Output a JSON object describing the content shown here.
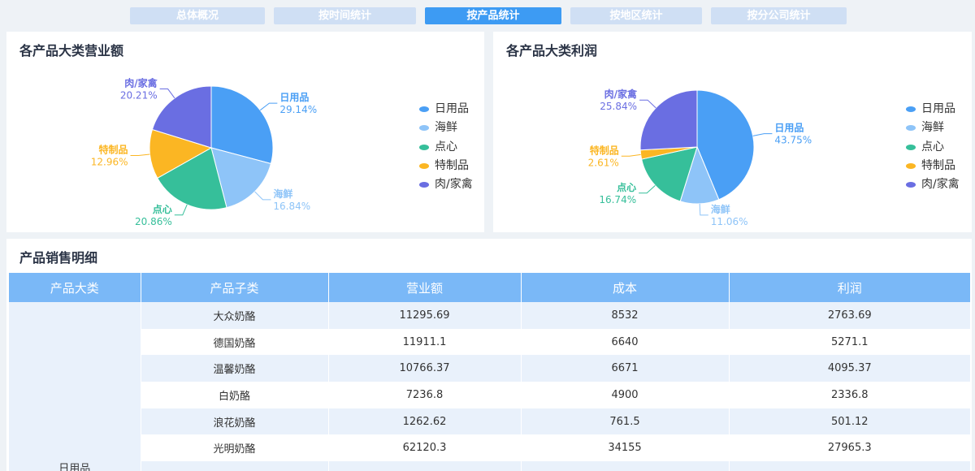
{
  "tabs": [
    "总体概况",
    "按时间统计",
    "按产品统计",
    "按地区统计",
    "按分公司统计"
  ],
  "active_tab": 2,
  "revenue_panel": {
    "title": "各产品大类营业额"
  },
  "profit_panel": {
    "title": "各产品大类利润"
  },
  "legend": [
    {
      "label": "日用品",
      "color": "#4a9ff5"
    },
    {
      "label": "海鲜",
      "color": "#8ec4f8"
    },
    {
      "label": "点心",
      "color": "#36bf9a"
    },
    {
      "label": "特制品",
      "color": "#fbb623"
    },
    {
      "label": "肉/家禽",
      "color": "#6a6ee2"
    }
  ],
  "chart_data": [
    {
      "type": "pie",
      "title": "各产品大类营业额",
      "categories": [
        "日用品",
        "海鲜",
        "点心",
        "特制品",
        "肉/家禽"
      ],
      "values": [
        29.14,
        16.84,
        20.86,
        12.96,
        20.21
      ],
      "labels": [
        "29.14%",
        "16.84%",
        "20.86%",
        "12.96%",
        "20.21%"
      ],
      "legend_position": "right"
    },
    {
      "type": "pie",
      "title": "各产品大类利润",
      "categories": [
        "日用品",
        "海鲜",
        "点心",
        "特制品",
        "肉/家禽"
      ],
      "values": [
        43.75,
        11.06,
        16.74,
        2.61,
        25.84
      ],
      "labels": [
        "43.75%",
        "11.06%",
        "16.74%",
        "2.61%",
        "25.84%"
      ],
      "legend_position": "right"
    }
  ],
  "table": {
    "title": "产品销售明细",
    "columns": [
      "产品大类",
      "产品子类",
      "营业额",
      "成本",
      "利润"
    ],
    "group": "日用品",
    "rows": [
      [
        "大众奶酪",
        "11295.69",
        "8532",
        "2763.69"
      ],
      [
        "德国奶酪",
        "11911.1",
        "6640",
        "5271.1"
      ],
      [
        "温馨奶酪",
        "10766.37",
        "6671",
        "4095.37"
      ],
      [
        "白奶酪",
        "7236.8",
        "4900",
        "2336.8"
      ],
      [
        "浪花奶酪",
        "1262.62",
        "761.5",
        "501.12"
      ],
      [
        "光明奶酪",
        "62120.3",
        "34155",
        "27965.3"
      ]
    ]
  }
}
